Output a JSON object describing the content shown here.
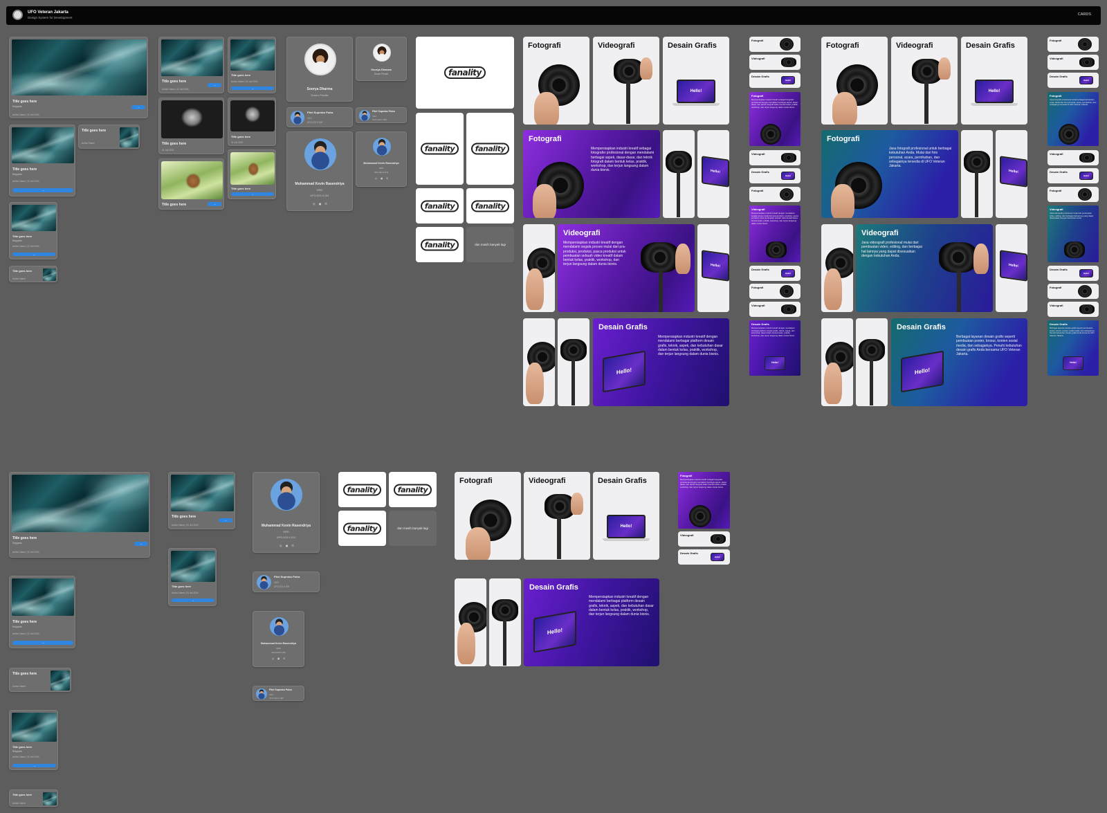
{
  "topbar": {
    "brand": "UFO Veteran Jakarta",
    "tagline": "Design System for Development",
    "page_label": "CARDS"
  },
  "blog": {
    "title": "Title goes here",
    "snippet": "Snippets",
    "author": "Author Name",
    "date": "31 Juli 2024",
    "button": "→"
  },
  "people": [
    {
      "name": "Soorya Dharma",
      "role": "Dosen Pendiri"
    },
    {
      "name": "Fikri Suprobo Putra",
      "role": "CEO",
      "id": "UFO.023.X.009"
    },
    {
      "name": "Muhammad Kevin Rasendriya",
      "role": "HRD",
      "id": "UFO.023.X.011"
    }
  ],
  "social_icons": "◎ ▣ ✆",
  "brand_logo": "fanality",
  "more_text": "dan masih banyak lagi",
  "services": {
    "foto": {
      "title": "Fotografi",
      "desc1": "Mempersiapkan industri kreatif sebagai fotografer profesional dengan mendalami berbagai aspek, dasar-dasar, dan teknik fotografi dalam bentuk kelas, praktik, workshop, dan terjun langsung dalam dunia bisnis.",
      "desc2": "Jasa fotografi profesional untuk berbagai kebutuhan Anda. Mulai dari foto personal, acara, pernikahan, dan sebagainya tersedia di UFO Veteran Jakarta."
    },
    "video": {
      "title": "Videografi",
      "desc1": "Mempersiapkan industri kreatif dengan mendalami segala proses mulai dari pra-produksi, produksi, pasca produksi untuk pembuatan sebuah video kreatif dalam bentuk kelas, praktik, workshop, dan terjun langsung dalam dunia bisnis.",
      "desc2": "Jasa videografi profesional mulai dari pembuatan video, editing, dan berbagai hal lainnya yang dapat disesuaikan dengan kebutuhan Anda."
    },
    "desain": {
      "title": "Desain Grafis",
      "desc1": "Mempersiapkan industri kreatif dengan mendalami berbagai platform desain grafis, teknik, aspek, dan kebutuhan dasar dalam bentuk kelas, praktik, workshop, dan terjun langsung dalam dunia bisnis.",
      "desc2": "Berbagai layanan desain grafis seperti pembuatan poster, brosur, konten sosial media, dan sebagainya. Penuhi kebutuhan desain grafis Anda bersama UFO Veteran Jakarta."
    },
    "laptop_text": "Hello!"
  }
}
